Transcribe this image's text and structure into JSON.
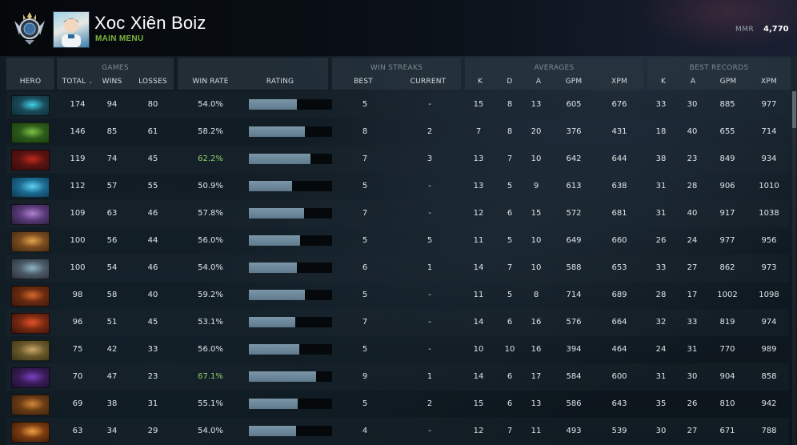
{
  "profile": {
    "name": "Xoc Xiên Boiz",
    "subtitle": "MAIN MENU",
    "mmr_label": "MMR",
    "mmr_value": "4,770"
  },
  "groups": {
    "games": "GAMES",
    "win_streaks": "WIN STREAKS",
    "averages": "AVERAGES",
    "best_records": "BEST RECORDS"
  },
  "columns": {
    "hero": "HERO",
    "total": "TOTAL",
    "wins": "WINS",
    "losses": "LOSSES",
    "win_rate": "WIN RATE",
    "rating": "RATING",
    "best": "BEST",
    "current": "CURRENT",
    "avg_k": "K",
    "avg_d": "D",
    "avg_a": "A",
    "avg_gpm": "GPM",
    "avg_xpm": "XPM",
    "rec_k": "K",
    "rec_a": "A",
    "rec_gpm": "GPM",
    "rec_xpm": "XPM"
  },
  "colors": {
    "win_rate_high": "#8fd06d",
    "main_menu": "#7fb640",
    "rating_fill": "#6a8698"
  },
  "rows": [
    {
      "hero_icon": "hero-portrait-cyan-skull",
      "total": "174",
      "wins": "94",
      "losses": "80",
      "win_rate": "54.0%",
      "rating": 0.58,
      "best": "5",
      "current": "-",
      "k": "15",
      "d": "8",
      "a": "13",
      "gpm": "605",
      "xpm": "676",
      "rk": "33",
      "ra": "30",
      "rgpm": "885",
      "rxpm": "977",
      "highlight": false
    },
    {
      "hero_icon": "hero-portrait-green-lizard",
      "total": "146",
      "wins": "85",
      "losses": "61",
      "win_rate": "58.2%",
      "rating": 0.67,
      "best": "8",
      "current": "2",
      "k": "7",
      "d": "8",
      "a": "20",
      "gpm": "376",
      "xpm": "431",
      "rk": "18",
      "ra": "40",
      "rgpm": "655",
      "rxpm": "714",
      "highlight": false
    },
    {
      "hero_icon": "hero-portrait-red-demon",
      "total": "119",
      "wins": "74",
      "losses": "45",
      "win_rate": "62.2%",
      "rating": 0.74,
      "best": "7",
      "current": "3",
      "k": "13",
      "d": "7",
      "a": "10",
      "gpm": "642",
      "xpm": "644",
      "rk": "38",
      "ra": "23",
      "rgpm": "849",
      "rxpm": "934",
      "highlight": true
    },
    {
      "hero_icon": "hero-portrait-blue-wave",
      "total": "112",
      "wins": "57",
      "losses": "55",
      "win_rate": "50.9%",
      "rating": 0.52,
      "best": "5",
      "current": "-",
      "k": "13",
      "d": "5",
      "a": "9",
      "gpm": "613",
      "xpm": "638",
      "rk": "31",
      "ra": "28",
      "rgpm": "906",
      "rxpm": "1010",
      "highlight": false
    },
    {
      "hero_icon": "hero-portrait-purple-rogue",
      "total": "109",
      "wins": "63",
      "losses": "46",
      "win_rate": "57.8%",
      "rating": 0.66,
      "best": "7",
      "current": "-",
      "k": "12",
      "d": "6",
      "a": "15",
      "gpm": "572",
      "xpm": "681",
      "rk": "31",
      "ra": "40",
      "rgpm": "917",
      "rxpm": "1038",
      "highlight": false
    },
    {
      "hero_icon": "hero-portrait-gold-warrior",
      "total": "100",
      "wins": "56",
      "losses": "44",
      "win_rate": "56.0%",
      "rating": 0.62,
      "best": "5",
      "current": "5",
      "k": "11",
      "d": "5",
      "a": "10",
      "gpm": "649",
      "xpm": "660",
      "rk": "26",
      "ra": "24",
      "rgpm": "977",
      "rxpm": "956",
      "highlight": false
    },
    {
      "hero_icon": "hero-portrait-armored-knight",
      "total": "100",
      "wins": "54",
      "losses": "46",
      "win_rate": "54.0%",
      "rating": 0.58,
      "best": "6",
      "current": "1",
      "k": "14",
      "d": "7",
      "a": "10",
      "gpm": "588",
      "xpm": "653",
      "rk": "33",
      "ra": "27",
      "rgpm": "862",
      "rxpm": "973",
      "highlight": false
    },
    {
      "hero_icon": "hero-portrait-horned-brute",
      "total": "98",
      "wins": "58",
      "losses": "40",
      "win_rate": "59.2%",
      "rating": 0.67,
      "best": "5",
      "current": "-",
      "k": "11",
      "d": "5",
      "a": "8",
      "gpm": "714",
      "xpm": "689",
      "rk": "28",
      "ra": "17",
      "rgpm": "1002",
      "rxpm": "1098",
      "highlight": false
    },
    {
      "hero_icon": "hero-portrait-fire-spirit",
      "total": "96",
      "wins": "51",
      "losses": "45",
      "win_rate": "53.1%",
      "rating": 0.56,
      "best": "7",
      "current": "-",
      "k": "14",
      "d": "6",
      "a": "16",
      "gpm": "576",
      "xpm": "664",
      "rk": "32",
      "ra": "33",
      "rgpm": "819",
      "rxpm": "974",
      "highlight": false
    },
    {
      "hero_icon": "hero-portrait-ogre",
      "total": "75",
      "wins": "42",
      "losses": "33",
      "win_rate": "56.0%",
      "rating": 0.61,
      "best": "5",
      "current": "-",
      "k": "10",
      "d": "10",
      "a": "16",
      "gpm": "394",
      "xpm": "464",
      "rk": "24",
      "ra": "31",
      "rgpm": "770",
      "rxpm": "989",
      "highlight": false
    },
    {
      "hero_icon": "hero-portrait-void-beast",
      "total": "70",
      "wins": "47",
      "losses": "23",
      "win_rate": "67.1%",
      "rating": 0.81,
      "best": "9",
      "current": "1",
      "k": "14",
      "d": "6",
      "a": "17",
      "gpm": "584",
      "xpm": "600",
      "rk": "31",
      "ra": "30",
      "rgpm": "904",
      "rxpm": "858",
      "highlight": true
    },
    {
      "hero_icon": "hero-portrait-tusked-warrior",
      "total": "69",
      "wins": "38",
      "losses": "31",
      "win_rate": "55.1%",
      "rating": 0.59,
      "best": "5",
      "current": "2",
      "k": "15",
      "d": "6",
      "a": "13",
      "gpm": "586",
      "xpm": "643",
      "rk": "35",
      "ra": "26",
      "rgpm": "810",
      "rxpm": "942",
      "highlight": false
    },
    {
      "hero_icon": "hero-portrait-flame-lady",
      "total": "63",
      "wins": "34",
      "losses": "29",
      "win_rate": "54.0%",
      "rating": 0.57,
      "best": "4",
      "current": "-",
      "k": "12",
      "d": "7",
      "a": "11",
      "gpm": "493",
      "xpm": "539",
      "rk": "30",
      "ra": "27",
      "rgpm": "671",
      "rxpm": "788",
      "highlight": false
    }
  ]
}
